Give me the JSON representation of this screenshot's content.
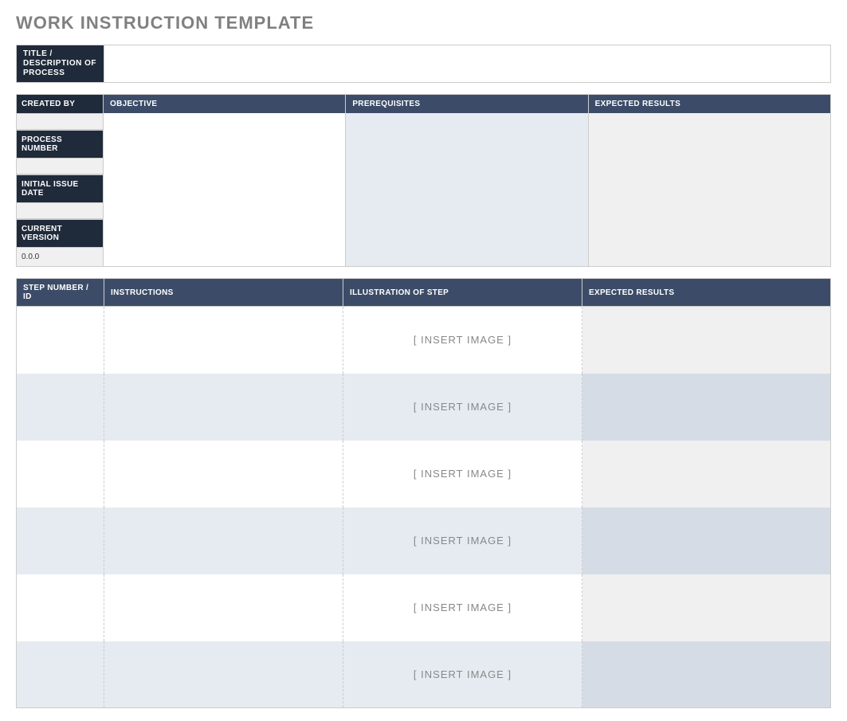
{
  "page_title": "WORK INSTRUCTION TEMPLATE",
  "titlebar": {
    "label": "TITLE / DESCRIPTION OF PROCESS",
    "value": ""
  },
  "overview": {
    "left": [
      {
        "label": "CREATED BY",
        "value": ""
      },
      {
        "label": "PROCESS NUMBER",
        "value": ""
      },
      {
        "label": "INITIAL ISSUE DATE",
        "value": ""
      },
      {
        "label": "CURRENT VERSION",
        "value": "0.0.0"
      }
    ],
    "right": [
      {
        "label": "OBJECTIVE",
        "body_class": "white"
      },
      {
        "label": "PREREQUISITES",
        "body_class": "pale"
      },
      {
        "label": "EXPECTED RESULTS",
        "body_class": "grey"
      }
    ]
  },
  "steps": {
    "headers": {
      "step": "STEP NUMBER / ID",
      "instructions": "INSTRUCTIONS",
      "illustration": "ILLUSTRATION OF STEP",
      "expected": "EXPECTED RESULTS"
    },
    "image_placeholder": "[ INSERT IMAGE ]",
    "rows": [
      {
        "step": "",
        "instructions": "",
        "expected": ""
      },
      {
        "step": "",
        "instructions": "",
        "expected": ""
      },
      {
        "step": "",
        "instructions": "",
        "expected": ""
      },
      {
        "step": "",
        "instructions": "",
        "expected": ""
      },
      {
        "step": "",
        "instructions": "",
        "expected": ""
      },
      {
        "step": "",
        "instructions": "",
        "expected": ""
      }
    ]
  }
}
